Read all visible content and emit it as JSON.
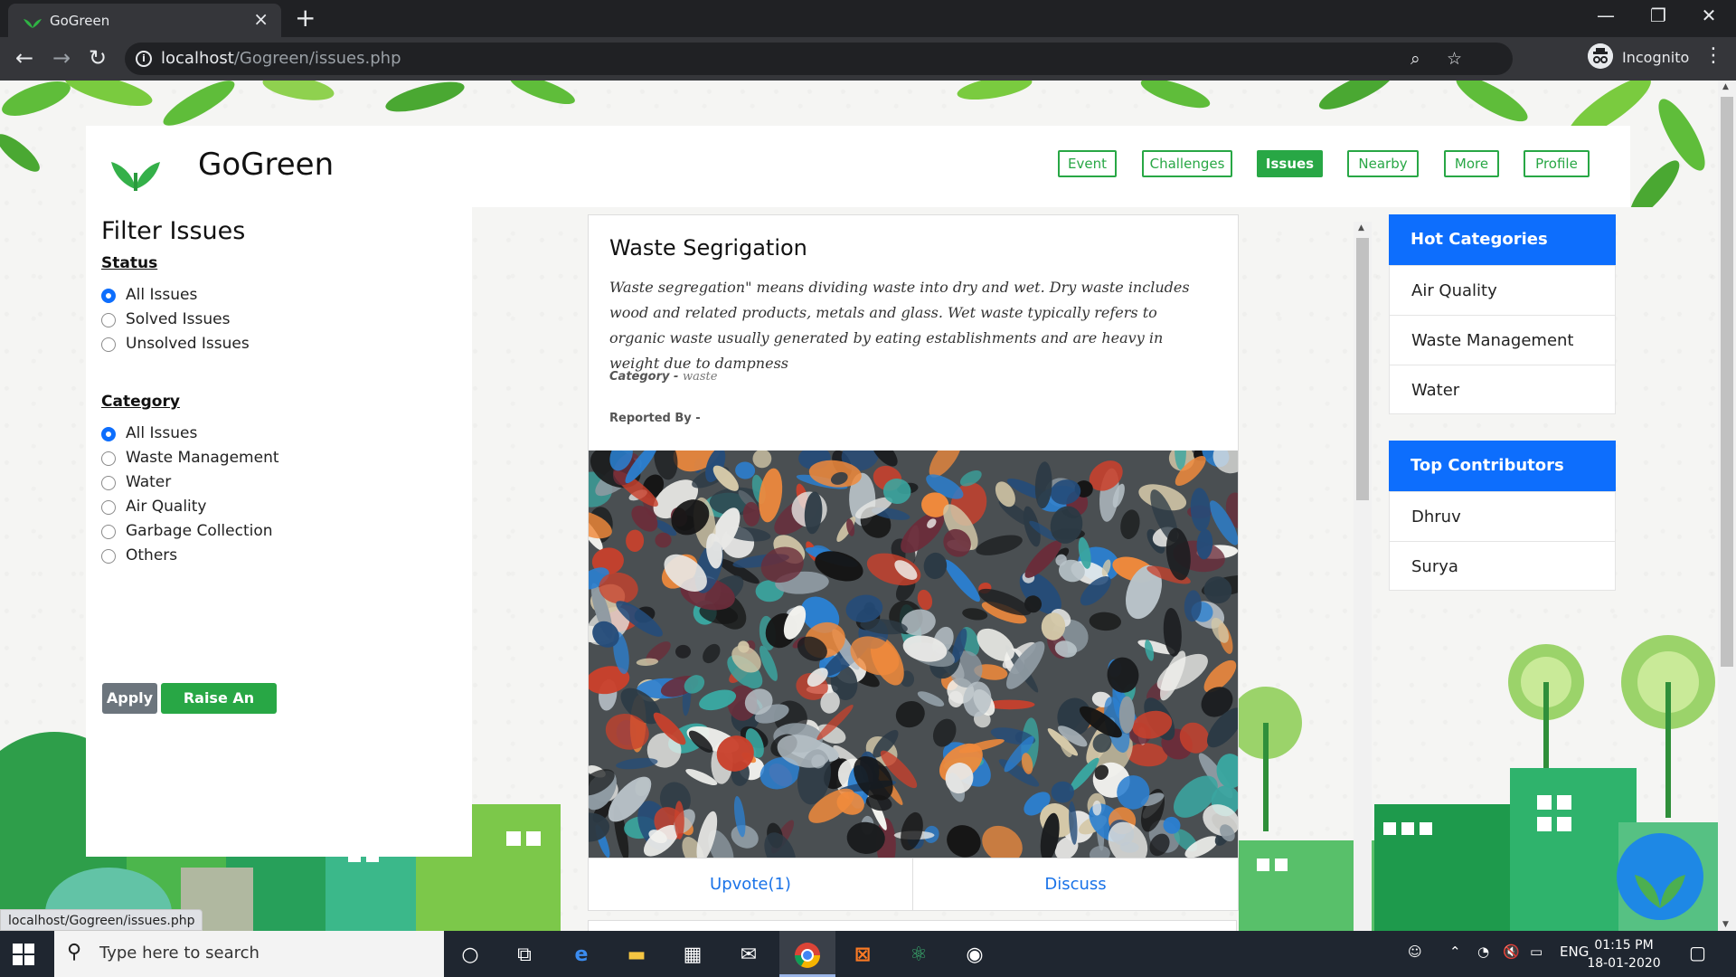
{
  "browser": {
    "tab_title": "GoGreen",
    "url_host": "localhost",
    "url_path": "/Gogreen/issues.php",
    "profile_label": "Incognito",
    "status_link": "localhost/Gogreen/issues.php"
  },
  "site": {
    "brand": "GoGreen",
    "nav": [
      "Event",
      "Challenges",
      "Issues",
      "Nearby",
      "More",
      "Profile"
    ],
    "active_nav": "Issues",
    "accent_color": "#28a745",
    "primary_color": "#0d6efd"
  },
  "filter": {
    "title": "Filter Issues",
    "status_heading": "Status",
    "status_options": [
      "All Issues",
      "Solved Issues",
      "Unsolved Issues"
    ],
    "status_selected": "All Issues",
    "category_heading": "Category",
    "category_options": [
      "All Issues",
      "Waste Management",
      "Water",
      "Air Quality",
      "Garbage Collection",
      "Others"
    ],
    "category_selected": "All Issues",
    "apply_label": "Apply",
    "raise_label": "Raise An Issue"
  },
  "issue": {
    "title": "Waste Segrigation",
    "description": "Waste segregation\" means dividing waste into dry and wet. Dry waste includes wood and related products, metals and glass. Wet waste typically refers to organic waste usually generated by eating establishments and are heavy in weight due to dampness",
    "category_label": "Category",
    "category_sep": "-",
    "category_value": "waste",
    "reported_label": "Reported By",
    "reported_sep": "-",
    "upvote_label": "Upvote(1)",
    "discuss_label": "Discuss"
  },
  "hot_categories": {
    "heading": "Hot Categories",
    "items": [
      "Air Quality",
      "Waste Management",
      "Water"
    ]
  },
  "top_contributors": {
    "heading": "Top Contributors",
    "items": [
      "Dhruv",
      "Surya"
    ]
  },
  "taskbar": {
    "search_placeholder": "Type here to search",
    "language": "ENG",
    "time": "01:15 PM",
    "date": "18-01-2020"
  }
}
